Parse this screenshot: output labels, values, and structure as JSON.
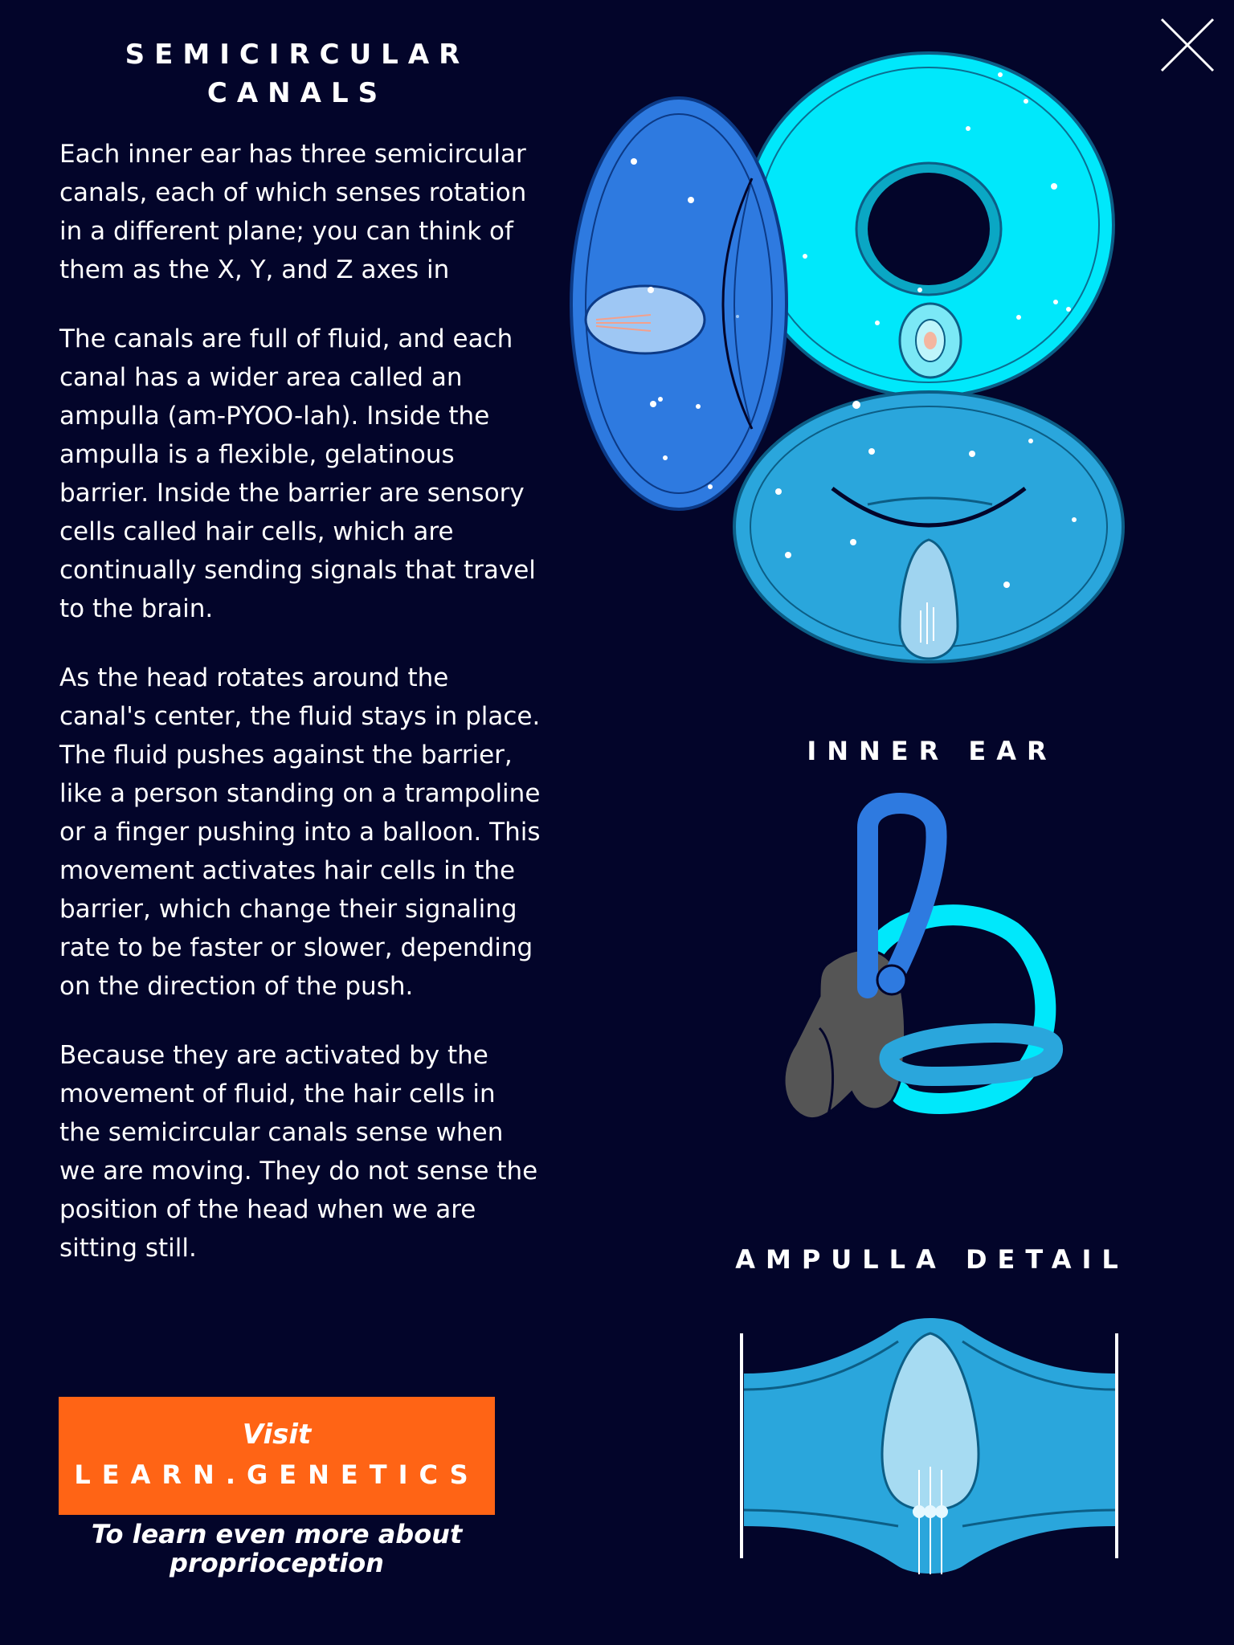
{
  "close_icon": "close-x-icon",
  "title": {
    "line1": "SEMICIRCULAR",
    "line2": "CANALS"
  },
  "paragraphs": [
    "Each inner ear has three semicircular canals, each of which senses rotation in a different plane; you can think of them as the X, Y, and Z axes in",
    "The canals are full of fluid, and each canal has a wider area called an ampulla (am-PYOO-lah). Inside the ampulla is a flexible, gelatinous barrier. Inside the barrier are sensory cells called hair cells, which are continually sending signals that travel to the brain.",
    "As the head rotates around the canal's center, the fluid stays in place. The fluid pushes against the barrier, like a person standing on a trampoline or a finger pushing into a balloon. This movement activates hair cells in the barrier, which change their signaling rate to be faster or slower, depending on the direction of the push.",
    "Because they are activated by the movement of fluid, the hair cells in the semicircular canals sense when we are moving. They do not sense the position of the head when we are sitting still."
  ],
  "cta": {
    "visit": "Visit",
    "site": "LEARN.GENETICS",
    "sub_line1": "To learn even more about",
    "sub_line2": "proprioception"
  },
  "labels": {
    "inner_ear": "INNER EAR",
    "ampulla_detail": "AMPULLA DETAIL"
  },
  "colors": {
    "background": "#03052a",
    "cta": "#ff6415",
    "canal_blue": "#2e7ae0",
    "canal_cyan": "#00e8fb",
    "canal_mid": "#2aa6dc",
    "vestibule_gray": "#555555"
  }
}
